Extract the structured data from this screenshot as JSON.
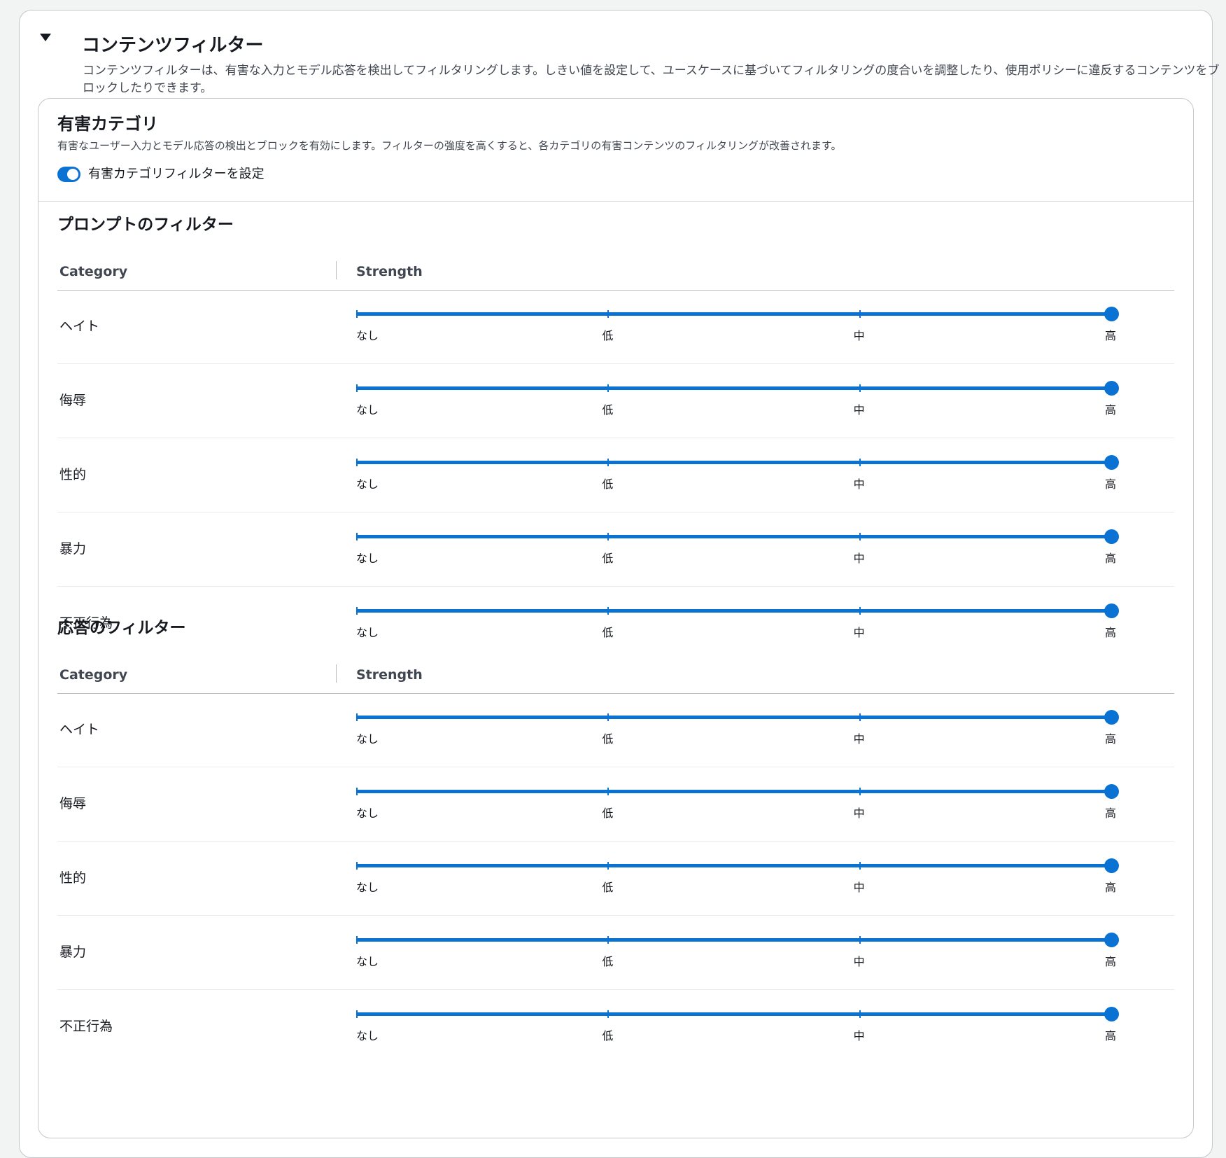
{
  "content_filter": {
    "title": "コンテンツフィルター",
    "description": "コンテンツフィルターは、有害な入力とモデル応答を検出してフィルタリングします。しきい値を設定して、ユースケースに基づいてフィルタリングの度合いを調整したり、使用ポリシーに違反するコンテンツをブロックしたりできます。",
    "expanded": true
  },
  "harmful_categories": {
    "title": "有害カテゴリ",
    "description": "有害なユーザー入力とモデル応答の検出とブロックを有効にします。フィルターの強度を高くすると、各カテゴリの有害コンテンツのフィルタリングが改善されます。",
    "toggle_label": "有害カテゴリフィルターを設定",
    "toggle_on": true,
    "accent_color": "#0972d3"
  },
  "strength_levels": [
    "なし",
    "低",
    "中",
    "高"
  ],
  "table_headers": {
    "category": "Category",
    "strength": "Strength"
  },
  "prompt_filters": {
    "title": "プロンプトのフィルター",
    "rows": [
      {
        "category": "ヘイト",
        "strength": "高"
      },
      {
        "category": "侮辱",
        "strength": "高"
      },
      {
        "category": "性的",
        "strength": "高"
      },
      {
        "category": "暴力",
        "strength": "高"
      },
      {
        "category": "不正行為",
        "strength": "高"
      }
    ]
  },
  "response_filters": {
    "title": "応答のフィルター",
    "rows": [
      {
        "category": "ヘイト",
        "strength": "高"
      },
      {
        "category": "侮辱",
        "strength": "高"
      },
      {
        "category": "性的",
        "strength": "高"
      },
      {
        "category": "暴力",
        "strength": "高"
      },
      {
        "category": "不正行為",
        "strength": "高"
      }
    ]
  }
}
